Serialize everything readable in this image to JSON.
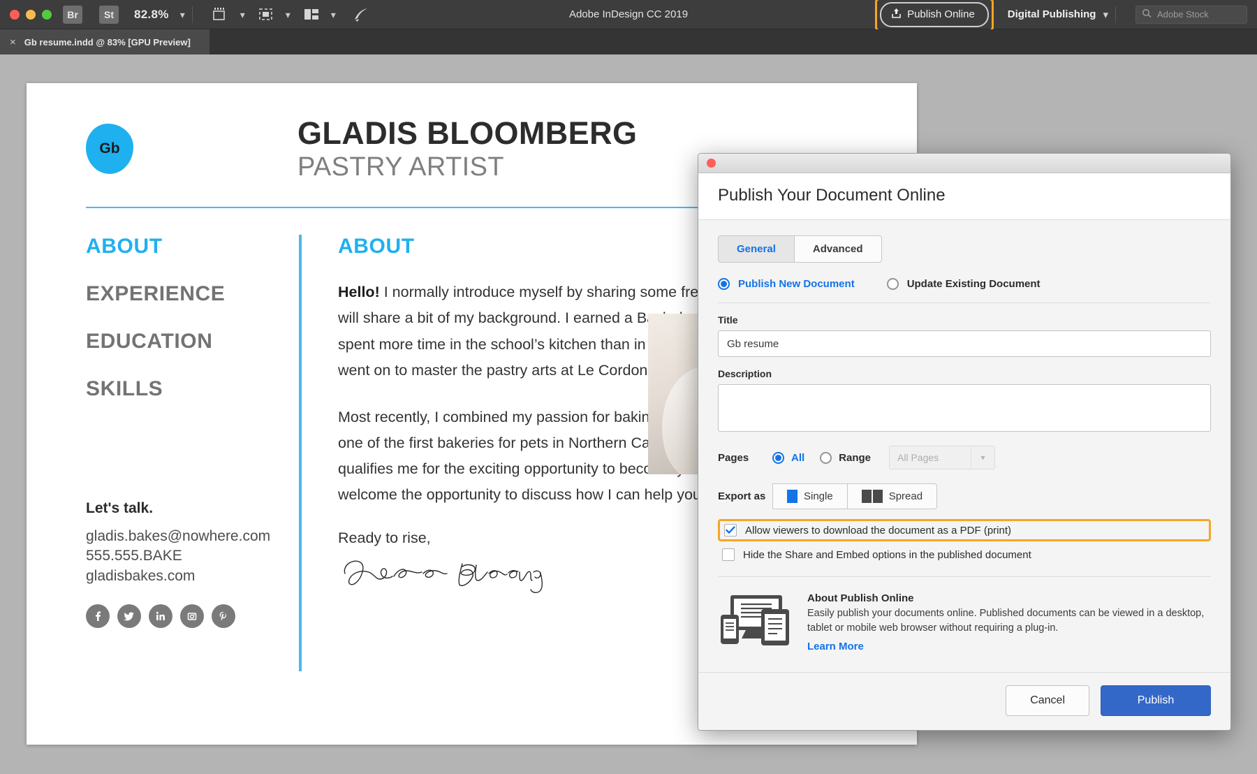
{
  "menubar": {
    "app_title": "Adobe InDesign CC 2019",
    "zoom_level": "82.8%",
    "bridge_label": "Br",
    "stock_label": "St",
    "publish_online_label": "Publish Online",
    "workspace_label": "Digital Publishing",
    "stock_search_placeholder": "Adobe Stock",
    "icons": {
      "share-icon": "share-up-icon",
      "chevron": "chevron-down-icon",
      "screen-mode": "screen-mode-icon",
      "view-mode": "view-mode-icon",
      "arrange": "arrange-documents-icon",
      "search": "search-icon",
      "rocket": "rocket-icon"
    },
    "highlight_color": "#f5a623"
  },
  "tabbar": {
    "document_tab": "Gb resume.indd @ 83% [GPU Preview]",
    "close_label": "×"
  },
  "document": {
    "logo_initials": "Gb",
    "name": "GLADIS BLOOMBERG",
    "role": "PASTRY ARTIST",
    "accent_color": "#1fb0ef",
    "nav": [
      {
        "label": "ABOUT",
        "active": true
      },
      {
        "label": "EXPERIENCE",
        "active": false
      },
      {
        "label": "EDUCATION",
        "active": false
      },
      {
        "label": "SKILLS",
        "active": false
      }
    ],
    "section_title": "ABOUT",
    "paragraph1_lead": "Hello!",
    "paragraph1": " I normally introduce myself by sharing some fresh-baked bread, but for now I will share a bit of my background. I earned a Bachelor’s degree in business, but spent more time in the school’s kitchen than in the lecture halls. So after graduation, I went on to master the pastry arts at Le Cordon Vert.",
    "paragraph2": "Most recently, I combined my passion for baking with my love of animals and opened one of the first bakeries for pets in Northern California. My success there is what qualifies me for the exciting opportunity to become your Lead Pastry Artist. I welcome the opportunity to discuss how I can help your business grow.",
    "closing": "Ready to rise,",
    "signature_alt": "Gladis Bloomberg",
    "contact_title": "Let's talk.",
    "contact_email": "gladis.bakes@nowhere.com",
    "contact_phone": "555.555.BAKE",
    "contact_site": "gladisbakes.com",
    "socials": [
      "facebook-icon",
      "twitter-icon",
      "linkedin-icon",
      "instagram-icon",
      "pinterest-icon"
    ]
  },
  "dialog": {
    "title": "Publish Your Document Online",
    "tabs": [
      {
        "label": "General",
        "active": true
      },
      {
        "label": "Advanced",
        "active": false
      }
    ],
    "mode": {
      "new_label": "Publish New Document",
      "update_label": "Update Existing Document",
      "selected": "new"
    },
    "title_field": {
      "label": "Title",
      "value": "Gb resume"
    },
    "description_field": {
      "label": "Description",
      "value": ""
    },
    "pages": {
      "label": "Pages",
      "all_label": "All",
      "range_label": "Range",
      "selected": "All",
      "range_value": "All Pages"
    },
    "export_as": {
      "label": "Export as",
      "single_label": "Single",
      "spread_label": "Spread",
      "selected": "Single"
    },
    "checkboxes": [
      {
        "label": "Allow viewers to download the document as a PDF (print)",
        "checked": true,
        "highlighted": true
      },
      {
        "label": "Hide the Share and Embed options in the published document",
        "checked": false,
        "highlighted": false
      }
    ],
    "about": {
      "heading": "About Publish Online",
      "body": "Easily publish your documents online. Published documents can be viewed in a desktop, tablet or mobile web browser without requiring a plug-in.",
      "link": "Learn More"
    },
    "cancel_label": "Cancel",
    "publish_label": "Publish",
    "accent_color": "#1473e6",
    "primary_button_color": "#3468c8",
    "highlight_color": "#f5a623"
  }
}
